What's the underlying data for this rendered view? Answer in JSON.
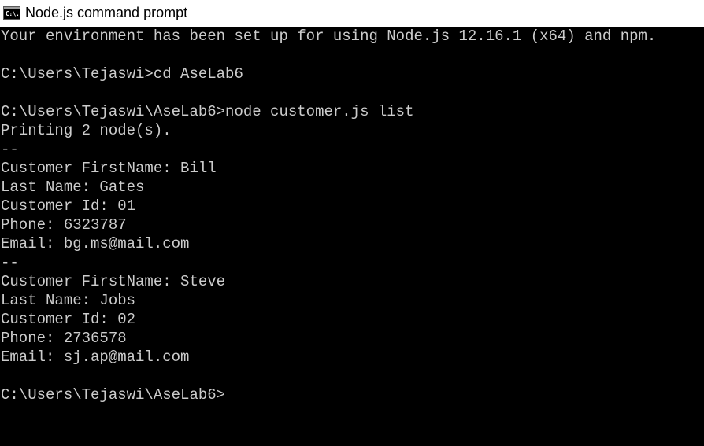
{
  "window": {
    "title": "Node.js command prompt",
    "icon": "console-icon",
    "icon_glyph": "C:\\."
  },
  "console": {
    "lines": [
      "Your environment has been set up for using Node.js 12.16.1 (x64) and npm.",
      "",
      "C:\\Users\\Tejaswi>cd AseLab6",
      "",
      "C:\\Users\\Tejaswi\\AseLab6>node customer.js list",
      "Printing 2 node(s).",
      "--",
      "Customer FirstName: Bill",
      "Last Name: Gates",
      "Customer Id: 01",
      "Phone: 6323787",
      "Email: bg.ms@mail.com",
      "--",
      "Customer FirstName: Steve",
      "Last Name: Jobs",
      "Customer Id: 02",
      "Phone: 2736578",
      "Email: sj.ap@mail.com",
      "",
      "C:\\Users\\Tejaswi\\AseLab6>"
    ]
  },
  "colors": {
    "console_bg": "#000000",
    "console_text": "#cccccc",
    "titlebar_bg": "#ffffff"
  }
}
